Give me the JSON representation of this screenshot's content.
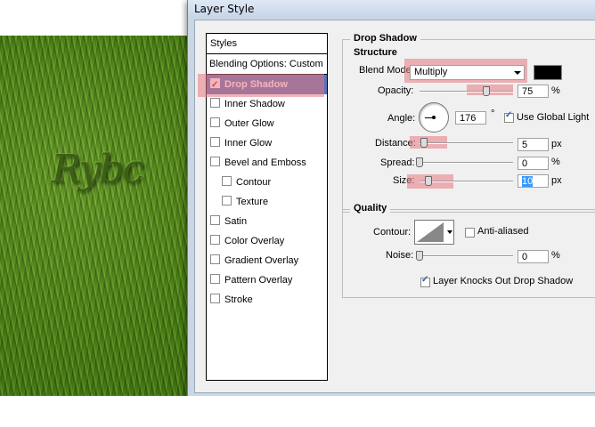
{
  "canvas": {
    "text": "Rybc"
  },
  "window": {
    "title": "Layer Style"
  },
  "styles_panel": {
    "header": "Styles",
    "blending_options": "Blending Options: Custom",
    "items": [
      {
        "label": "Drop Shadow",
        "checked": true,
        "selected": true,
        "sub": false
      },
      {
        "label": "Inner Shadow",
        "checked": false,
        "selected": false,
        "sub": false
      },
      {
        "label": "Outer Glow",
        "checked": false,
        "selected": false,
        "sub": false
      },
      {
        "label": "Inner Glow",
        "checked": false,
        "selected": false,
        "sub": false
      },
      {
        "label": "Bevel and Emboss",
        "checked": false,
        "selected": false,
        "sub": false
      },
      {
        "label": "Contour",
        "checked": false,
        "selected": false,
        "sub": true
      },
      {
        "label": "Texture",
        "checked": false,
        "selected": false,
        "sub": true
      },
      {
        "label": "Satin",
        "checked": false,
        "selected": false,
        "sub": false
      },
      {
        "label": "Color Overlay",
        "checked": false,
        "selected": false,
        "sub": false
      },
      {
        "label": "Gradient Overlay",
        "checked": false,
        "selected": false,
        "sub": false
      },
      {
        "label": "Pattern Overlay",
        "checked": false,
        "selected": false,
        "sub": false
      },
      {
        "label": "Stroke",
        "checked": false,
        "selected": false,
        "sub": false
      }
    ]
  },
  "drop_shadow": {
    "group_title": "Drop Shadow",
    "structure_title": "Structure",
    "blend_mode_label": "Blend Mode:",
    "blend_mode_value": "Multiply",
    "shadow_color": "#000000",
    "opacity_label": "Opacity:",
    "opacity_value": "75",
    "opacity_unit": "%",
    "angle_label": "Angle:",
    "angle_value": "176",
    "angle_unit": "°",
    "use_global_light_label": "Use Global Light",
    "use_global_light_checked": true,
    "distance_label": "Distance:",
    "distance_value": "5",
    "distance_unit": "px",
    "spread_label": "Spread:",
    "spread_value": "0",
    "spread_unit": "%",
    "size_label": "Size:",
    "size_value": "10",
    "size_unit": "px"
  },
  "quality": {
    "group_title": "Quality",
    "contour_label": "Contour:",
    "anti_aliased_label": "Anti-aliased",
    "anti_aliased_checked": false,
    "noise_label": "Noise:",
    "noise_value": "0",
    "noise_unit": "%",
    "knockout_label": "Layer Knocks Out Drop Shadow",
    "knockout_checked": true
  },
  "highlight_color": "#e67882",
  "selection_color": "#5d72b8"
}
